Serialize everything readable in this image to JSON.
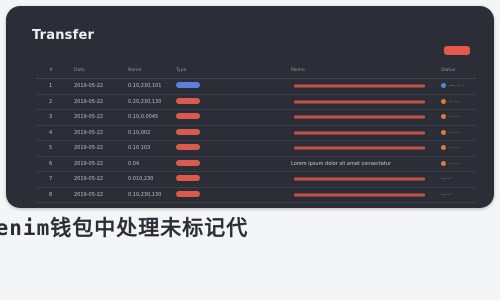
{
  "header": {
    "title": "Transfer"
  },
  "colors": {
    "panel": "#2b2e36",
    "accent_red": "#e4594b",
    "pill_blue": "#5a7fd8",
    "status_orange": "#e07b3c",
    "status_blue": "#4f8ad9"
  },
  "table": {
    "columns": [
      "#",
      "Date",
      "Name",
      "Type",
      "",
      "Memo",
      "Status"
    ],
    "rows": [
      {
        "num": "1",
        "date": "2019-05-22",
        "name": "0.10,230,101",
        "pill": "blue",
        "col5": "",
        "memo": "",
        "status_dot": "blue",
        "status": "···· ·· ·"
      },
      {
        "num": "2",
        "date": "2019-05-22",
        "name": "0.20,230,130",
        "pill": "red",
        "col5": "",
        "memo": "",
        "status_dot": "orange",
        "status": "·· ·· ·"
      },
      {
        "num": "3",
        "date": "2019-05-22",
        "name": "0.10,0.0045",
        "pill": "red",
        "col5": "",
        "memo": "",
        "status_dot": "orange",
        "status": "·· ·· ·"
      },
      {
        "num": "4",
        "date": "2019-05-22",
        "name": "0.10,002",
        "pill": "red",
        "col5": "",
        "memo": "",
        "status_dot": "orange",
        "status": "·· ·· ·"
      },
      {
        "num": "5",
        "date": "2019-05-22",
        "name": "0.10 103",
        "pill": "red",
        "col5": "",
        "memo": "",
        "status_dot": "orange",
        "status": "·· ·· ·"
      },
      {
        "num": "6",
        "date": "2019-05-22",
        "name": "0.04",
        "pill": "red",
        "col5": "",
        "memo": "Lorem ipsum dolor sit amet consectetur",
        "status_dot": "orange",
        "status": "·· ·· ·"
      },
      {
        "num": "7",
        "date": "2019-05-22",
        "name": "0.010,230",
        "pill": "red",
        "col5": "",
        "memo": "",
        "status_dot": "",
        "status": "——"
      },
      {
        "num": "8",
        "date": "2019-05-22",
        "name": "0.10,230,130",
        "pill": "red",
        "col5": "",
        "memo": "",
        "status_dot": "",
        "status": "——"
      }
    ]
  },
  "banner": {
    "text": "kenim钱包中处理未标记代"
  }
}
